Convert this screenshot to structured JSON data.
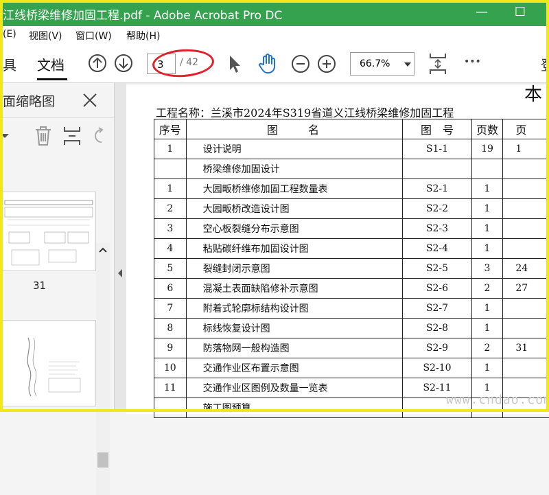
{
  "window": {
    "title": "江线桥梁维修加固工程.pdf - Adobe Acrobat Pro DC"
  },
  "menu": [
    "(E)",
    "视图(V)",
    "窗口(W)",
    "帮助(H)"
  ],
  "toolbar": {
    "tab_tools": "具",
    "tab_document": "文档",
    "page_current": "3",
    "page_total": "/ 42",
    "zoom": "66.7%",
    "more": "•••",
    "right_edge_char": "登"
  },
  "sidepanel": {
    "title": "面缩略图",
    "thumbnail_label": "31"
  },
  "document": {
    "project_title": "工程名称：兰溪市2024年S319省道义江线桥梁维修加固工程",
    "corner_char": "本",
    "headers": [
      "序号",
      "图　　名",
      "图　号",
      "页数",
      "页"
    ],
    "rows": [
      {
        "no": "1",
        "name": "设计说明",
        "code": "S1-1",
        "pages": "19",
        "page": "1"
      },
      {
        "no": "",
        "name": "桥梁维修加固设计",
        "code": "",
        "pages": "",
        "page": "",
        "section": true
      },
      {
        "no": "1",
        "name": "大园畈桥维修加固工程数量表",
        "code": "S2-1",
        "pages": "1",
        "page": ""
      },
      {
        "no": "2",
        "name": "大园畈桥改造设计图",
        "code": "S2-2",
        "pages": "1",
        "page": ""
      },
      {
        "no": "3",
        "name": "空心板裂缝分布示意图",
        "code": "S2-3",
        "pages": "1",
        "page": ""
      },
      {
        "no": "4",
        "name": "粘贴碳纤维布加固设计图",
        "code": "S2-4",
        "pages": "1",
        "page": ""
      },
      {
        "no": "5",
        "name": "裂缝封闭示意图",
        "code": "S2-5",
        "pages": "3",
        "page": "24"
      },
      {
        "no": "6",
        "name": "混凝土表面缺陷修补示意图",
        "code": "S2-6",
        "pages": "2",
        "page": "27"
      },
      {
        "no": "7",
        "name": "附着式轮廓标结构设计图",
        "code": "S2-7",
        "pages": "1",
        "page": ""
      },
      {
        "no": "8",
        "name": "标线恢复设计图",
        "code": "S2-8",
        "pages": "1",
        "page": ""
      },
      {
        "no": "9",
        "name": "防落物网一般构造图",
        "code": "S2-9",
        "pages": "2",
        "page": "31"
      },
      {
        "no": "10",
        "name": "交通作业区布置示意图",
        "code": "S2-10",
        "pages": "1",
        "page": ""
      },
      {
        "no": "11",
        "name": "交通作业区图例及数量一览表",
        "code": "S2-11",
        "pages": "1",
        "page": ""
      },
      {
        "no": "",
        "name": "施工图预算",
        "code": "",
        "pages": "",
        "page": "",
        "section": true
      }
    ]
  },
  "watermark": "www.cndao.com",
  "colors": {
    "titlebar": "#35a24f",
    "highlight_oval": "#e1202a",
    "frame": "#f0e81a"
  }
}
